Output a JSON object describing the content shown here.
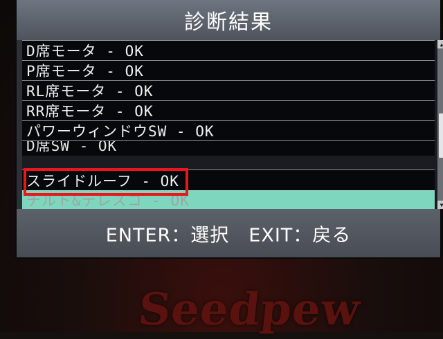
{
  "screen": {
    "title": "診断結果",
    "items": [
      {
        "label": "D席モータ - OK"
      },
      {
        "label": "P席モータ - OK"
      },
      {
        "label": "RL席モータ - OK"
      },
      {
        "label": "RR席モータ - OK"
      },
      {
        "label": "パワーウィンドウSW - OK"
      },
      {
        "label": "D席SW - OK"
      },
      {
        "label": "スライドルーフ - OK"
      },
      {
        "label": "チルト&テレスコ - OK"
      }
    ],
    "selected_index": 7,
    "footer": "ENTER：選択　EXIT：戻る"
  },
  "device": {
    "brand": "Seedpew"
  },
  "colors": {
    "row_bg": "#07080b",
    "selected_bg": "#7ed6be",
    "highlight_box": "#e8171d",
    "title_bar": "#5e636c"
  },
  "icons": {
    "scroll_up": "triangle-up-icon",
    "scroll_down": "triangle-down-icon"
  }
}
